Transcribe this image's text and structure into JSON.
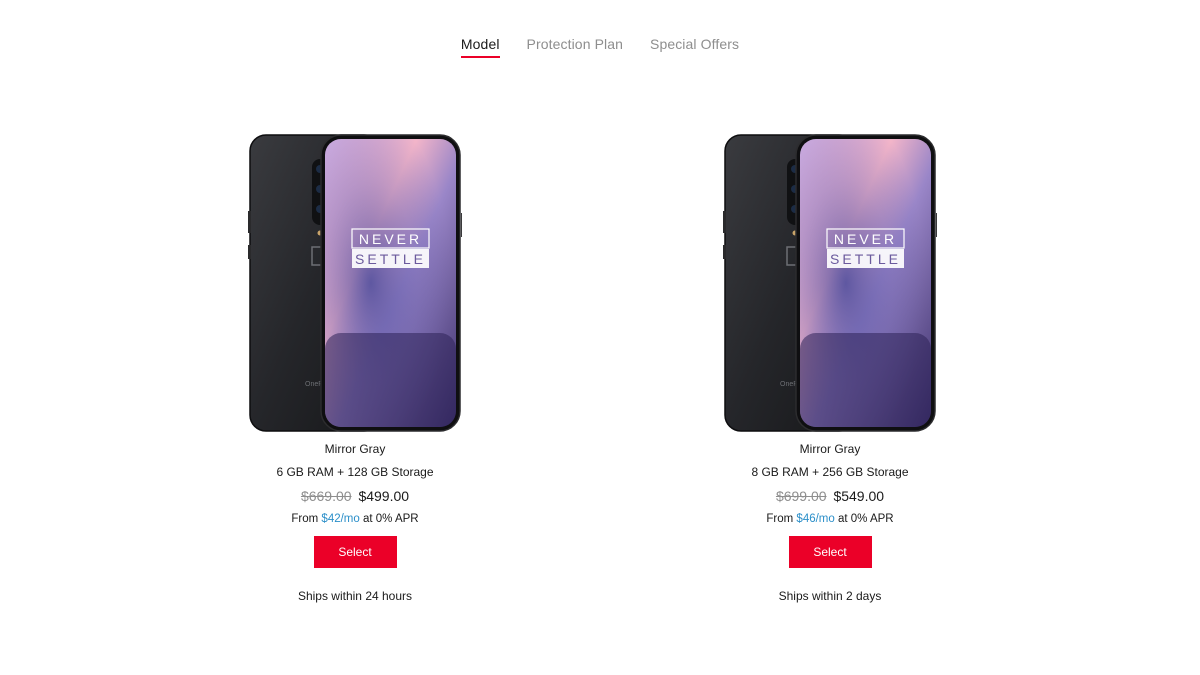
{
  "tabs": [
    {
      "label": "Model",
      "active": true
    },
    {
      "label": "Protection Plan",
      "active": false
    },
    {
      "label": "Special Offers",
      "active": false
    }
  ],
  "products": [
    {
      "color": "Mirror Gray",
      "config": "6 GB RAM + 128 GB Storage",
      "old_price": "$669.00",
      "price": "$499.00",
      "finance_prefix": "From ",
      "finance_monthly": "$42/mo",
      "finance_suffix": " at 0% APR",
      "select_label": "Select",
      "shipping": "Ships within 24 hours",
      "screen_text_line1": "NEVER",
      "screen_text_line2": "SETTLE",
      "back_brand": "OneP"
    },
    {
      "color": "Mirror Gray",
      "config": "8 GB RAM + 256 GB Storage",
      "old_price": "$699.00",
      "price": "$549.00",
      "finance_prefix": "From ",
      "finance_monthly": "$46/mo",
      "finance_suffix": " at 0% APR",
      "select_label": "Select",
      "shipping": "Ships within 2 days",
      "screen_text_line1": "NEVER",
      "screen_text_line2": "SETTLE",
      "back_brand": "OneP"
    }
  ],
  "colors": {
    "accent": "#eb0028",
    "link": "#2b8fc9",
    "muted": "#8e8e8e"
  }
}
